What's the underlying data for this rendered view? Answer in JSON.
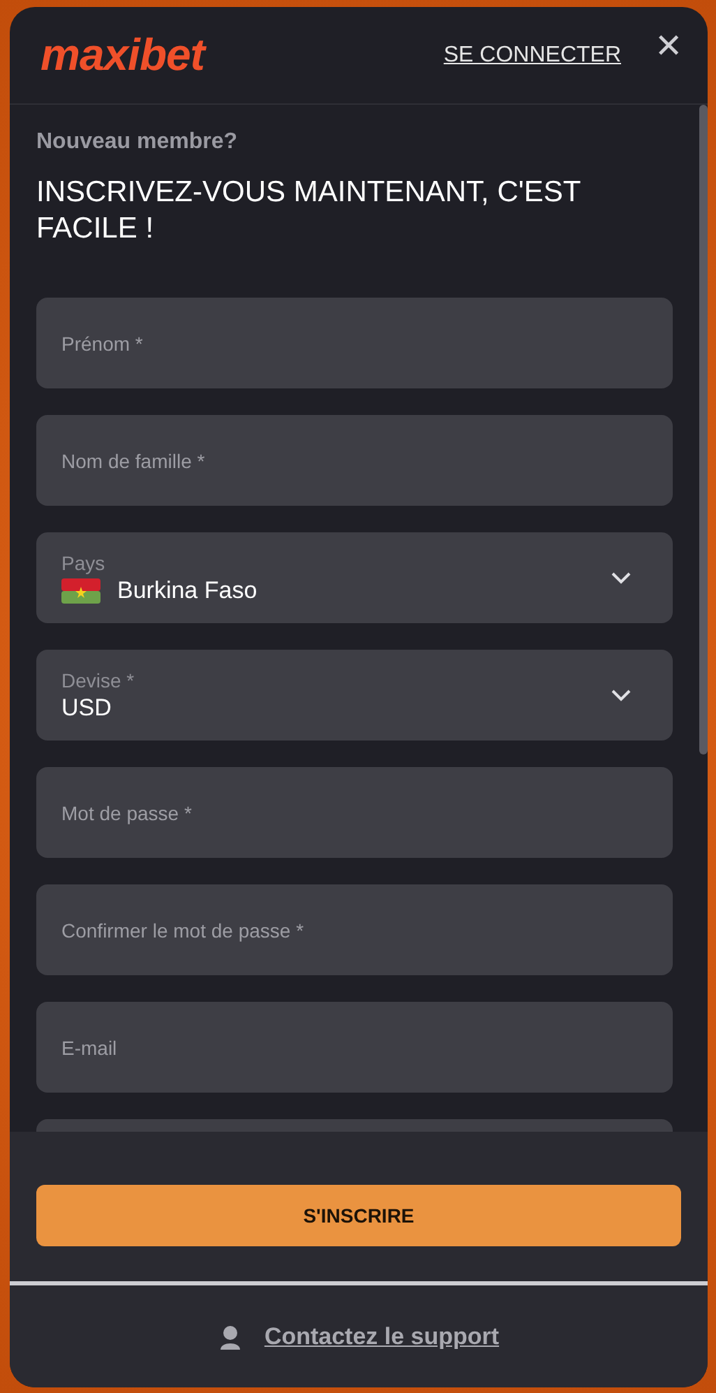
{
  "header": {
    "logo": "maxibet",
    "login_link": "SE CONNECTER",
    "close": "✕"
  },
  "intro": {
    "subtitle": "Nouveau membre?",
    "title": "INSCRIVEZ-VOUS MAINTENANT, C'EST FACILE !"
  },
  "fields": [
    {
      "kind": "text",
      "placeholder": "Prénom *"
    },
    {
      "kind": "text",
      "placeholder": "Nom de famille *"
    },
    {
      "kind": "select",
      "label": "Pays",
      "value": "Burkina Faso",
      "flag": true
    },
    {
      "kind": "select",
      "label": "Devise *",
      "value": "USD",
      "flag": false
    },
    {
      "kind": "text",
      "placeholder": "Mot de passe *"
    },
    {
      "kind": "text",
      "placeholder": "Confirmer le mot de passe *"
    },
    {
      "kind": "text",
      "placeholder": "E-mail"
    },
    {
      "kind": "text"
    }
  ],
  "submit": "S'INSCRIRE",
  "support_link": "Contactez le support"
}
